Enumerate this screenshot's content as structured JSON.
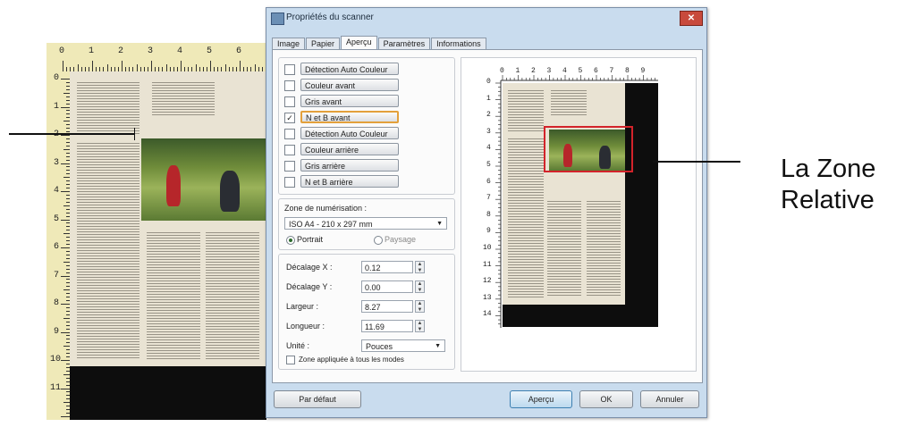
{
  "background_scan": {
    "ruler_top_numbers": [
      "0",
      "1",
      "2",
      "3",
      "4",
      "5",
      "6"
    ],
    "ruler_left_numbers": [
      "0",
      "1",
      "2",
      "3",
      "4",
      "5",
      "6",
      "7",
      "8",
      "9",
      "10",
      "11"
    ]
  },
  "dialog": {
    "title": "Propriétés du scanner",
    "close_label": "✕",
    "tabs": [
      "Image",
      "Papier",
      "Aperçu",
      "Paramètres",
      "Informations"
    ],
    "active_tab": "Aperçu",
    "options": [
      {
        "label": "Détection Auto Couleur Recto",
        "checked": false
      },
      {
        "label": "Couleur avant",
        "checked": false
      },
      {
        "label": "Gris avant",
        "checked": false
      },
      {
        "label": "N et B avant",
        "checked": true
      },
      {
        "label": "Détection Auto Couleur Verso",
        "checked": false
      },
      {
        "label": "Couleur arrière",
        "checked": false
      },
      {
        "label": "Gris arrière",
        "checked": false
      },
      {
        "label": "N et B arrière",
        "checked": false
      }
    ],
    "check_mark": "✓",
    "scan_zone": {
      "label": "Zone de numérisation :",
      "value": "ISO A4 - 210 x 297 mm",
      "arrow": "▼",
      "portrait_label": "Portrait",
      "landscape_label": "Paysage"
    },
    "offsets": {
      "offset_x_label": "Décalage X :",
      "offset_x_value": "0.12",
      "offset_y_label": "Décalage Y :",
      "offset_y_value": "0.00",
      "width_label": "Largeur :",
      "width_value": "8.27",
      "length_label": "Longueur :",
      "length_value": "11.69",
      "unit_label": "Unité :",
      "unit_value": "Pouces",
      "spin_up": "▲",
      "spin_down": "▼",
      "apply_all_label": "Zone appliquée à tous les modes"
    },
    "preview": {
      "ruler_top_numbers": [
        "0",
        "1",
        "2",
        "3",
        "4",
        "5",
        "6",
        "7",
        "8",
        "9"
      ],
      "ruler_left_numbers": [
        "0",
        "1",
        "2",
        "3",
        "4",
        "5",
        "6",
        "7",
        "8",
        "9",
        "10",
        "11",
        "12",
        "13",
        "14"
      ]
    },
    "buttons": {
      "default": "Par défaut",
      "preview": "Aperçu",
      "ok": "OK",
      "cancel": "Annuler"
    }
  },
  "annotation": {
    "line1": "La Zone",
    "line2": "Relative"
  }
}
